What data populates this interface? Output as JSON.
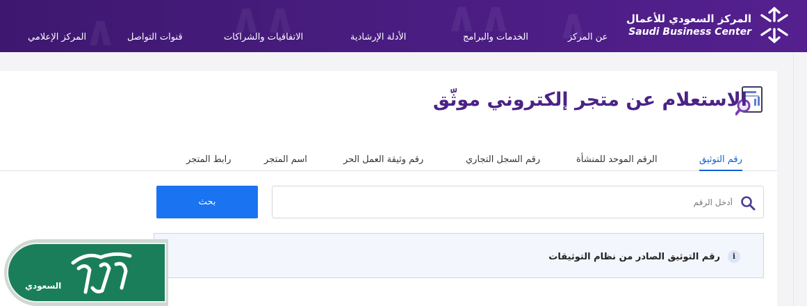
{
  "header": {
    "logo_ar": "المركز السعودي للأعمال",
    "logo_en": "Saudi Business Center",
    "nav": [
      {
        "label": "عن المركز"
      },
      {
        "label": "الخدمات والبرامج"
      },
      {
        "label": "الأدلة الإرشادية"
      },
      {
        "label": "الاتفاقيات والشراكات"
      },
      {
        "label": "قنوات التواصل"
      },
      {
        "label": "المركز الإعلامي"
      }
    ]
  },
  "page": {
    "title": "الاستعلام عن متجر إلكتروني موثّق"
  },
  "tabs": [
    {
      "label": "رقم التوثيق",
      "active": true
    },
    {
      "label": "الرقم الموحد للمنشأة",
      "active": false
    },
    {
      "label": "رقم السجل التجاري",
      "active": false
    },
    {
      "label": "رقم وثيقة العمل الحر",
      "active": false
    },
    {
      "label": "اسم المتجر",
      "active": false
    },
    {
      "label": "رابط المتجر",
      "active": false
    }
  ],
  "search": {
    "placeholder": "أدخل الرقم",
    "value": "",
    "button_label": "بحث"
  },
  "info": {
    "text": "رقم التوثيق الصادر من نظام التوثيقات",
    "icon_glyph": "i"
  },
  "watermark": {
    "brand_logo_text": "المرجع",
    "brand_sub": "السعودي"
  },
  "colors": {
    "header_bg": "#4a1d82",
    "title": "#4b2386",
    "accent_blue": "#1a73f0",
    "active_tab": "#0d60d8",
    "badge_green": "#1a7e5b"
  },
  "icons": {
    "logo": "sbc-star-logo-icon",
    "title": "document-search-icon",
    "search": "search-icon",
    "info": "info-icon"
  }
}
